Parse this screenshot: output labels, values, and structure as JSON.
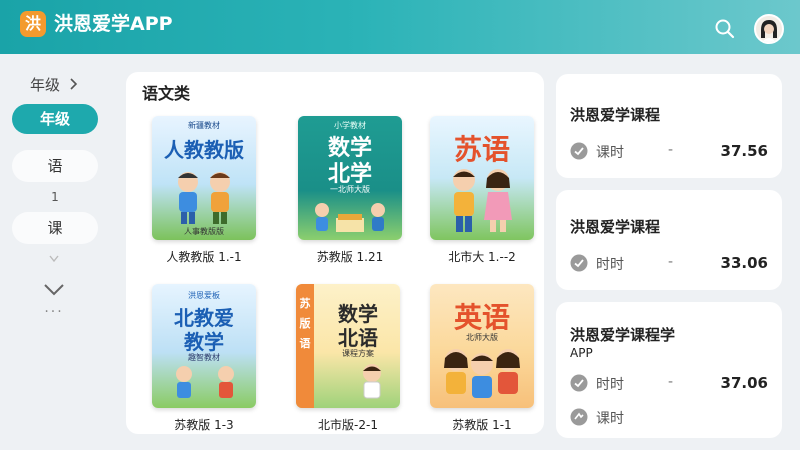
{
  "header": {
    "logo_char": "洪",
    "app_title": "洪恩爱学APP",
    "search_icon": "search-icon",
    "avatar_icon": "user-avatar"
  },
  "sidebar": {
    "grade_heading": "年级",
    "grade_button": "年级",
    "item_1": "语",
    "item_num": "1",
    "item_2": "课",
    "chevron_small": "chevron-down-icon",
    "chevron_large": "chevron-down-icon",
    "more": "···"
  },
  "main": {
    "section_title": "语文类",
    "books": [
      {
        "cover_line1": "人教教版",
        "cover_line2": "",
        "cover_top": "新疆教材",
        "cover_bottom": "人事教版版",
        "label": "人教教版 1.-1"
      },
      {
        "cover_line1": "数学",
        "cover_line2": "北学",
        "cover_top": "小学教材",
        "cover_bottom": "一北师大版",
        "label": "苏教版 1.21"
      },
      {
        "cover_line1": "苏语",
        "cover_line2": "",
        "cover_top": "",
        "cover_bottom": "",
        "label": "北市大 1.--2"
      },
      {
        "cover_line1": "北教爱",
        "cover_line2": "教学",
        "cover_top": "洪恩爱板",
        "cover_bottom": "趣智教材",
        "label": "苏教版 1-3"
      },
      {
        "cover_line1": "数学",
        "cover_line2": "北语",
        "cover_top": "",
        "cover_bottom": "课程方案",
        "label": "北市版-2-1"
      },
      {
        "cover_line1": "英语",
        "cover_line2": "",
        "cover_top": "",
        "cover_bottom": "北师大版",
        "label": "苏教版 1-1"
      }
    ]
  },
  "courses": [
    {
      "title": "洪恩爱学课程",
      "subtitle": "",
      "rows": [
        {
          "label": "课时",
          "dash": "-",
          "value": "37.56"
        }
      ]
    },
    {
      "title": "洪恩爱学课程",
      "subtitle": "",
      "rows": [
        {
          "label": "时时",
          "dash": "-",
          "value": "33.06"
        }
      ]
    },
    {
      "title": "洪恩爱学课程学",
      "subtitle": "APP",
      "rows": [
        {
          "label": "时时",
          "dash": "-",
          "value": "37.06"
        },
        {
          "label": "课时",
          "dash": "",
          "value": ""
        }
      ]
    }
  ],
  "colors": {
    "accent": "#1ea9ad",
    "logo": "#f39a2e"
  }
}
